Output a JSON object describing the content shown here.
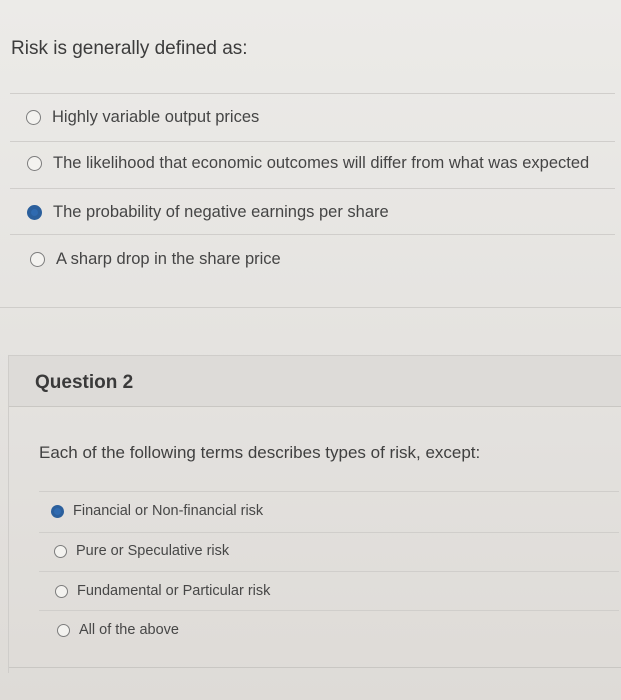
{
  "question1": {
    "text": "Risk is generally defined as:",
    "options": [
      {
        "label": "Highly variable output prices",
        "selected": false
      },
      {
        "label": "The likelihood that economic outcomes will differ from what was expected",
        "selected": false
      },
      {
        "label": "The probability of negative earnings per share",
        "selected": true
      },
      {
        "label": "A sharp drop in the share price",
        "selected": false
      }
    ]
  },
  "question2": {
    "title": "Question 2",
    "text": "Each of the following terms describes types of risk, except:",
    "options": [
      {
        "label": "Financial or Non-financial risk",
        "selected": true
      },
      {
        "label": "Pure or Speculative risk",
        "selected": false
      },
      {
        "label": "Fundamental or Particular risk",
        "selected": false
      },
      {
        "label": "All of the above",
        "selected": false
      }
    ]
  },
  "colors": {
    "accent": "#2b5f9c",
    "background": "#e6e4e1",
    "text": "#3f3f3f"
  }
}
